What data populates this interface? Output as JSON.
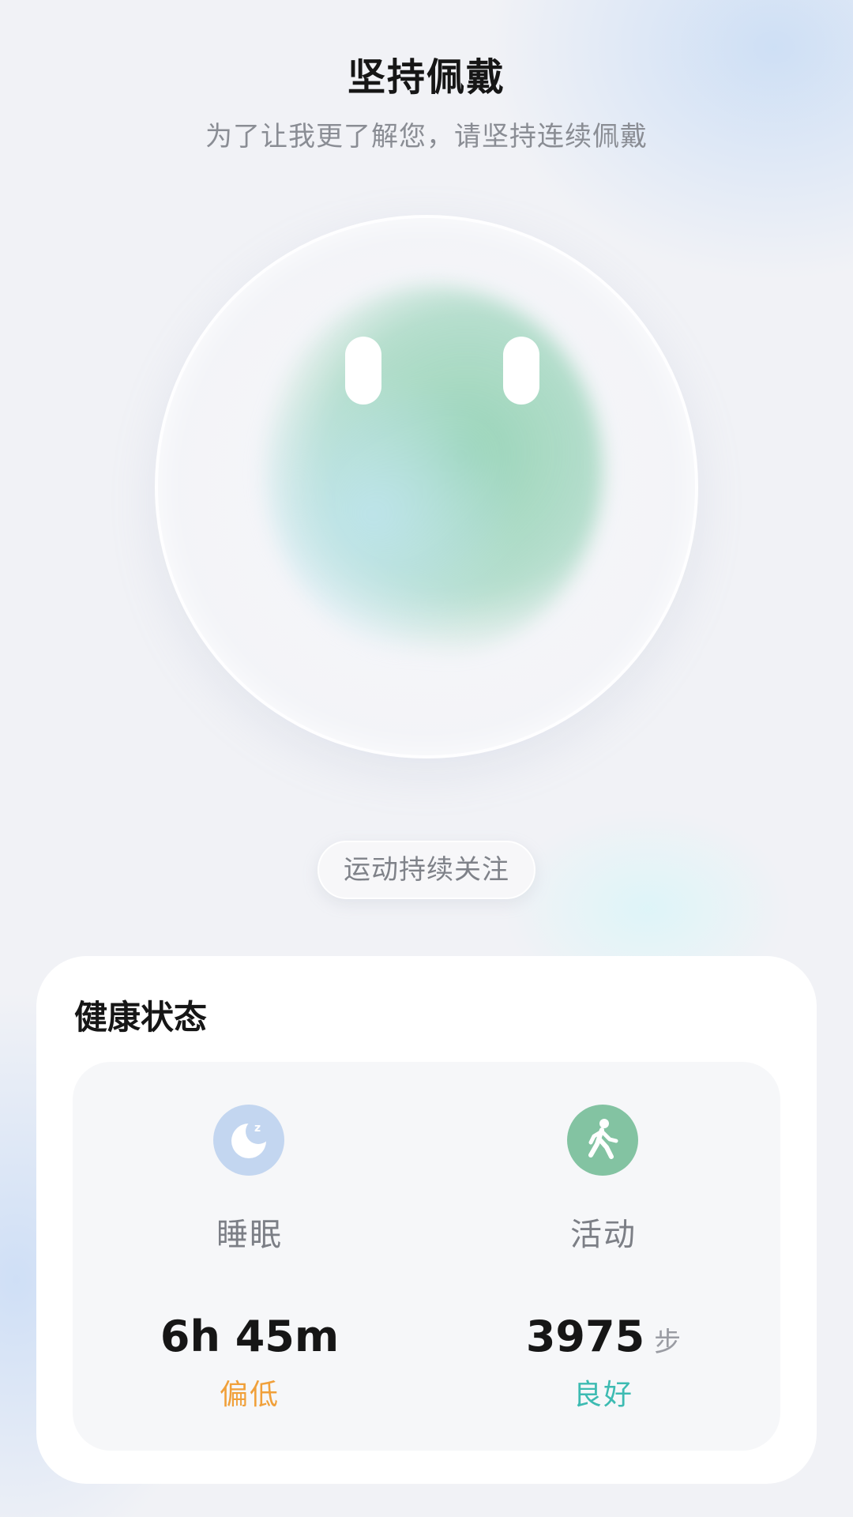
{
  "header": {
    "title": "坚持佩戴",
    "subtitle": "为了让我更了解您，请坚持连续佩戴"
  },
  "chip": {
    "label": "运动持续关注"
  },
  "health_card": {
    "title": "健康状态",
    "metrics": [
      {
        "icon": "sleep-moon-icon",
        "label": "睡眠",
        "value": "6h 45m",
        "unit": "",
        "status": "偏低",
        "status_color": "#f0a03a",
        "icon_bg": "#c3d6f0"
      },
      {
        "icon": "walking-person-icon",
        "label": "活动",
        "value": "3975",
        "unit": "步",
        "status": "良好",
        "status_color": "#3dbbb2",
        "icon_bg": "#83c3a2"
      }
    ]
  }
}
